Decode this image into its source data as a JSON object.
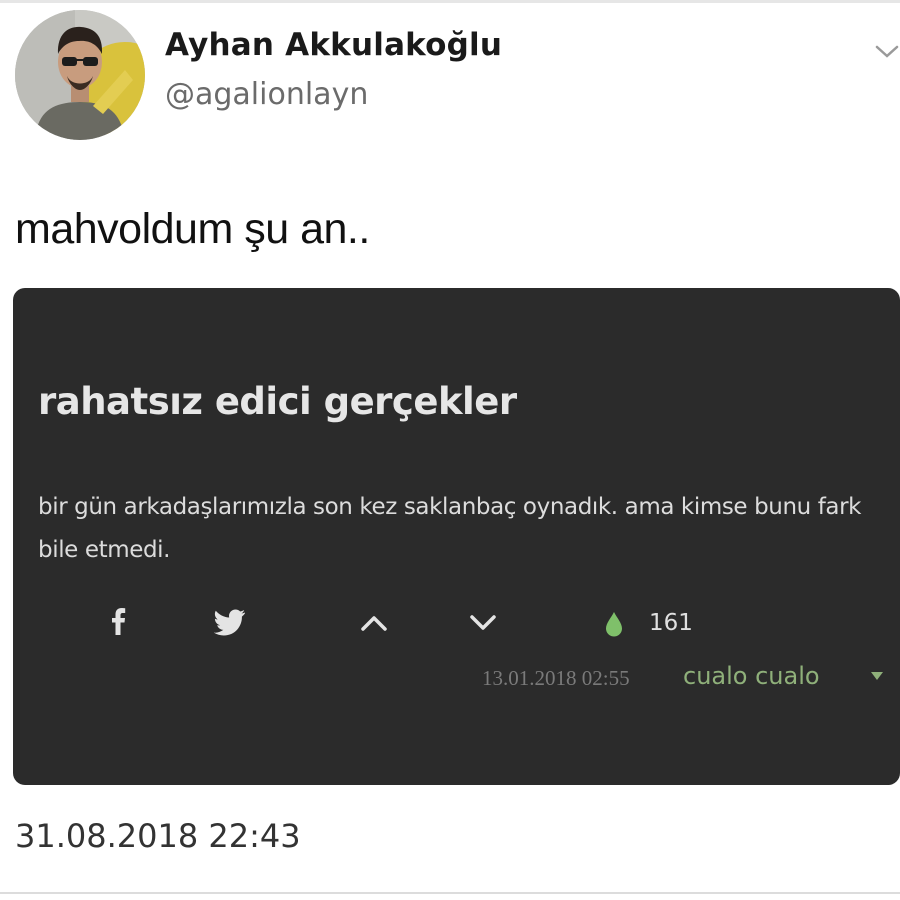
{
  "author": {
    "name": "Ayhan Akkulakoğlu",
    "handle": "@agalionlayn",
    "avatar_icon": "profile-photo"
  },
  "tweet": {
    "text": "mahvoldum şu an..",
    "timestamp": "31.08.2018 22:43",
    "menu_icon": "chevron-down-icon"
  },
  "embedded_card": {
    "title": "rahatsız edici gerçekler",
    "body": "bir gün arkadaşlarımızla son kez saklanbaç oynadık. ama kimse bunu fark bile etmedi.",
    "actions": {
      "facebook_icon": "facebook-icon",
      "twitter_icon": "twitter-bird-icon",
      "upvote_icon": "chevron-up-icon",
      "downvote_icon": "chevron-down-icon",
      "drop_icon": "water-drop-icon",
      "count": "161"
    },
    "date": "13.01.2018 02:55",
    "username": "cualo cualo",
    "colors": {
      "background": "#2b2b2b",
      "username": "#8fb07a",
      "drop": "#7fc06a"
    }
  }
}
